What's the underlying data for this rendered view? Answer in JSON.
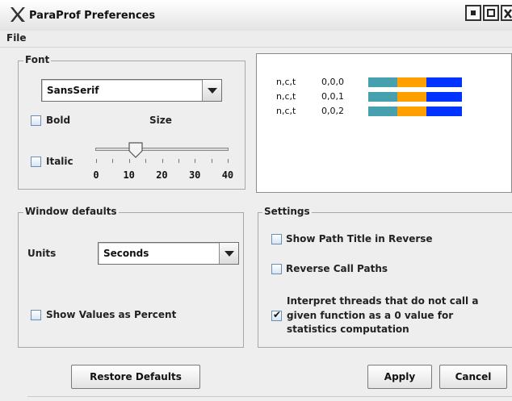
{
  "window": {
    "title": "ParaProf Preferences",
    "menu": [
      "File"
    ]
  },
  "font_group": {
    "legend": "Font",
    "font_name": "SansSerif",
    "bold_label": "Bold",
    "bold_checked": false,
    "italic_label": "Italic",
    "italic_checked": false,
    "size_label": "Size",
    "size_value": 12,
    "size_ticks": [
      "0",
      "10",
      "20",
      "30",
      "40"
    ],
    "size_range": [
      0,
      40
    ]
  },
  "preview": {
    "rows": [
      {
        "label": "n,c,t",
        "value": "0,0,0"
      },
      {
        "label": "n,c,t",
        "value": "0,0,1"
      },
      {
        "label": "n,c,t",
        "value": "0,0,2"
      }
    ],
    "bar_colors": [
      "#47a0ad",
      "#ff9f00",
      "#0033ff"
    ],
    "bar_fractions": [
      0.31,
      0.31,
      0.38
    ]
  },
  "window_defaults": {
    "legend": "Window defaults",
    "units_label": "Units",
    "units_value": "Seconds",
    "show_percent_label": "Show Values as Percent",
    "show_percent_checked": false
  },
  "settings": {
    "legend": "Settings",
    "path_reverse_label": "Show Path Title in Reverse",
    "path_reverse_checked": false,
    "reverse_call_label": "Reverse Call Paths",
    "reverse_call_checked": false,
    "interpret_line1": "Interpret threads that do not call a",
    "interpret_line2": "given function as a 0 value for",
    "interpret_line3": "statistics computation",
    "interpret_checked": true
  },
  "buttons": {
    "restore": "Restore Defaults",
    "apply": "Apply",
    "cancel": "Cancel"
  }
}
